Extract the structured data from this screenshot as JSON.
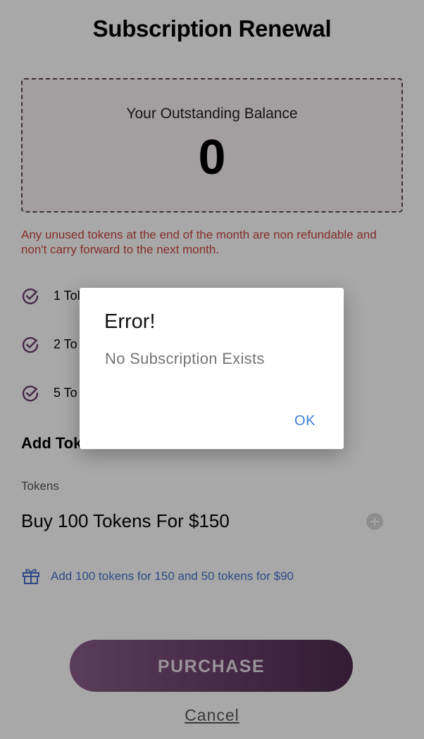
{
  "page": {
    "title": "Subscription Renewal",
    "balance": {
      "label": "Your Outstanding Balance",
      "value": "0"
    },
    "warning": "Any unused tokens at the end of the month are non refundable and non't carry forward to the next month.",
    "plans": [
      {
        "label": "1 Tol"
      },
      {
        "label": "2 To"
      },
      {
        "label": "5 To"
      }
    ],
    "add_tokens_title": "Add Tok",
    "tokens_field": {
      "label": "Tokens",
      "value": "Buy 100 Tokens For $150"
    },
    "offer_text": "Add 100 tokens for 150 and 50 tokens for $90",
    "purchase_label": "PURCHASE",
    "cancel_label": "Cancel"
  },
  "dialog": {
    "title": "Error!",
    "message": "No Subscription Exists",
    "ok_label": "OK"
  },
  "colors": {
    "warning": "#c9473e",
    "link_blue": "#4a6fd1",
    "purchase_gradient_start": "#8a5d8a",
    "purchase_gradient_end": "#4d2a4e",
    "check_icon": "#6b3f6c",
    "overlay": "rgba(0,0,0,0.34)"
  },
  "icons": {
    "plan_check": "check-circle-icon",
    "add_token": "plus-circle-icon",
    "offer": "gift-icon"
  }
}
